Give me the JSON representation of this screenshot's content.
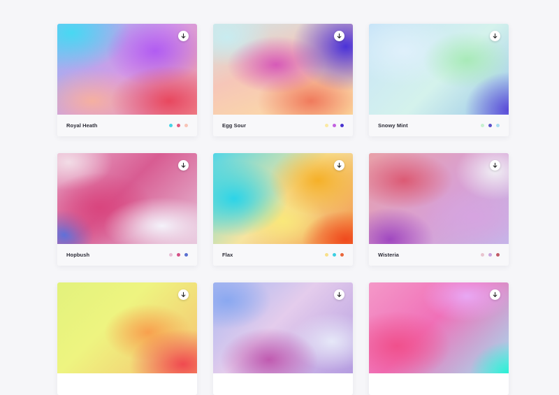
{
  "cards": [
    {
      "name": "Royal Heath",
      "swatches": [
        "#45d3e6",
        "#e35a7c",
        "#f8c3b6"
      ],
      "icon": "download-icon"
    },
    {
      "name": "Egg Sour",
      "swatches": [
        "#fbe9a3",
        "#c261e0",
        "#4a34cf"
      ],
      "icon": "download-icon"
    },
    {
      "name": "Snowy Mint",
      "swatches": [
        "#c6f0d0",
        "#5a4fc8",
        "#a9dcf0"
      ],
      "icon": "download-icon"
    },
    {
      "name": "Hopbush",
      "swatches": [
        "#e8bfd6",
        "#d44f86",
        "#5a6fd0"
      ],
      "icon": "download-icon"
    },
    {
      "name": "Flax",
      "swatches": [
        "#f8e08a",
        "#3ccfe2",
        "#e9663a"
      ],
      "icon": "download-icon"
    },
    {
      "name": "Wisteria",
      "swatches": [
        "#e8c4cf",
        "#c9a4de",
        "#c05a66"
      ],
      "icon": "download-icon"
    },
    {
      "name": "",
      "swatches": [],
      "icon": "download-icon"
    },
    {
      "name": "",
      "swatches": [],
      "icon": "download-icon"
    },
    {
      "name": "",
      "swatches": [],
      "icon": "download-icon"
    }
  ]
}
